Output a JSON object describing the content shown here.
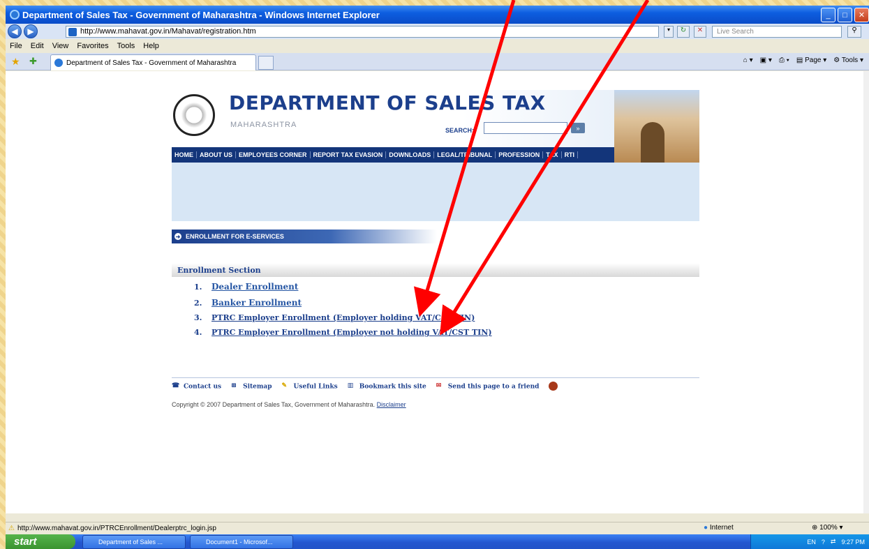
{
  "window": {
    "title": "Department of Sales Tax - Government of Maharashtra - Windows Internet Explorer"
  },
  "address_bar": {
    "url": "http://www.mahavat.gov.in/Mahavat/registration.htm",
    "search_placeholder": "Live Search"
  },
  "menu": [
    "File",
    "Edit",
    "View",
    "Favorites",
    "Tools",
    "Help"
  ],
  "tab": {
    "title": "Department of Sales Tax - Government of Maharashtra"
  },
  "toolbar": {
    "page_label": "Page",
    "tools_label": "Tools"
  },
  "site": {
    "heading": "DEPARTMENT OF SALES TAX",
    "state": "MAHARASHTRA",
    "search_label": "SEARCH:",
    "nav": [
      "HOME",
      "ABOUT US",
      "EMPLOYEES CORNER",
      "REPORT TAX EVASION",
      "DOWNLOADS",
      "LEGAL/TRIBUNAL",
      "PROFESSION",
      "TAX",
      "RTI"
    ],
    "section_banner": "ENROLLMENT FOR E-SERVICES",
    "section_title": "Enrollment Section",
    "items": [
      {
        "num": "1.",
        "label": "Dealer Enrollment"
      },
      {
        "num": "2.",
        "label": "Banker Enrollment"
      },
      {
        "num": "3.",
        "label": "PTRC Employer Enrollment (Employer holding VAT/CST TIN)"
      },
      {
        "num": "4.",
        "label": "PTRC Employer Enrollment (Employer not holding VAT/CST TIN)"
      }
    ],
    "footer_links": [
      "Contact us",
      "Sitemap",
      "Useful Links",
      "Bookmark this site",
      "Send this page to a friend"
    ],
    "copyright": "Copyright © 2007 Department of Sales Tax, Government of Maharashtra.",
    "disclaimer": "Disclaimer"
  },
  "status_bar": {
    "url": "http://www.mahavat.gov.in/PTRCEnrollment/Dealerptrc_login.jsp",
    "zone": "Internet",
    "zoom": "100%"
  },
  "taskbar": {
    "start": "start",
    "tasks": [
      "Department of Sales ...",
      "Document1 - Microsof..."
    ],
    "lang": "EN",
    "clock": "9:27 PM"
  },
  "colors": {
    "annotation_arrows": "#ff0000",
    "site_blue": "#1c3f8c"
  }
}
